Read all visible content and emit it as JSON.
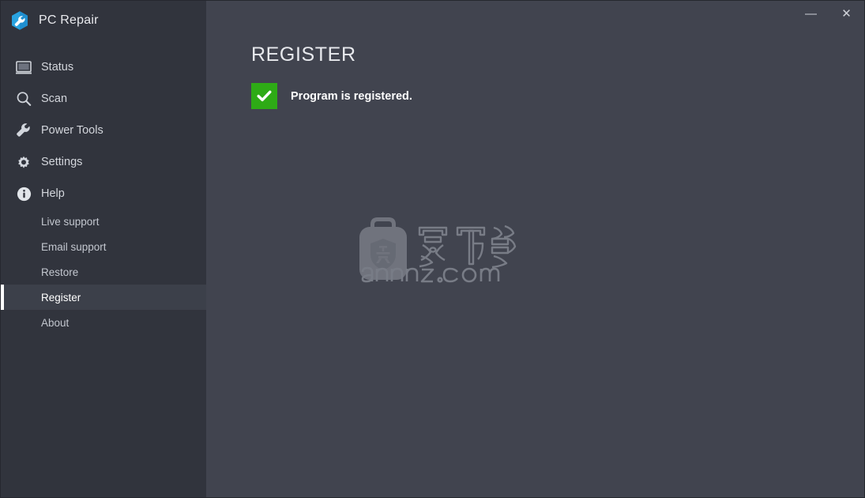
{
  "window": {
    "title": "PC Repair",
    "logo_icon": "wrench-hexagon-logo",
    "controls": [
      {
        "name": "minimize",
        "glyph": "—"
      },
      {
        "name": "close",
        "glyph": "✕"
      }
    ]
  },
  "sidebar": {
    "items": [
      {
        "label": "Status",
        "icon": "monitor-icon"
      },
      {
        "label": "Scan",
        "icon": "magnifier-icon"
      },
      {
        "label": "Power Tools",
        "icon": "wrench-icon"
      },
      {
        "label": "Settings",
        "icon": "gear-icon"
      },
      {
        "label": "Help",
        "icon": "info-circle-icon"
      }
    ],
    "sub_items": [
      {
        "label": "Live support",
        "selected": false
      },
      {
        "label": "Email support",
        "selected": false
      },
      {
        "label": "Restore",
        "selected": false
      },
      {
        "label": "Register",
        "selected": true
      },
      {
        "label": "About",
        "selected": false
      }
    ]
  },
  "main": {
    "page_title": "REGISTER",
    "status": {
      "icon": "check-icon",
      "text": "Program is registered."
    }
  },
  "watermark": {
    "icon": "bag-shield-icon",
    "cn_text": "安下载",
    "site": "anxz.com"
  },
  "colors": {
    "sidebar_bg": "#31343d",
    "main_bg": "#41444f",
    "selected_bg": "#3c404a",
    "selected_bar": "#ffffff",
    "accent_green": "#2eab16",
    "logo_blue": "#29a3e0",
    "text_primary": "#e7e9ed",
    "text_secondary": "#c3c7cf"
  }
}
